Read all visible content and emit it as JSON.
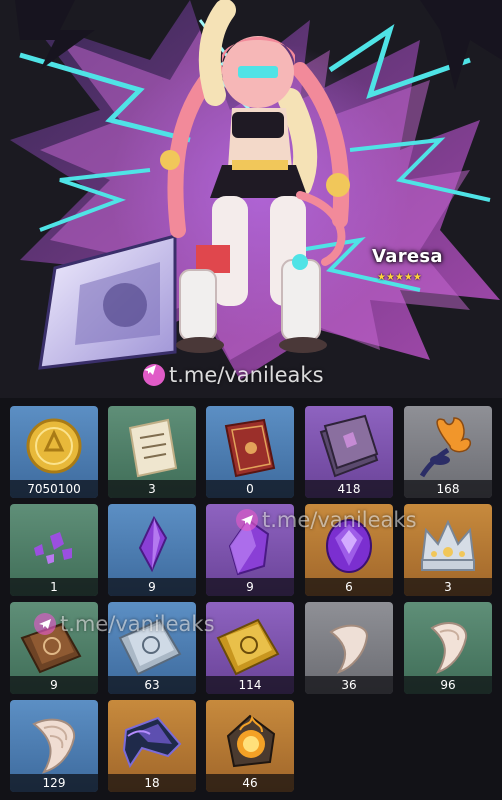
{
  "character": {
    "name": "Varesa",
    "stars": "★★★★★"
  },
  "watermark": {
    "text": "t.me/vanileaks"
  },
  "items": [
    {
      "count": "7050100",
      "icon": "mora-coin-icon",
      "rarity": "blue"
    },
    {
      "count": "3",
      "icon": "paper-note-icon",
      "rarity": "green"
    },
    {
      "count": "0",
      "icon": "red-book-icon",
      "rarity": "blue"
    },
    {
      "count": "418",
      "icon": "purple-book-stack-icon",
      "rarity": "purple"
    },
    {
      "count": "168",
      "icon": "orange-flower-icon",
      "rarity": "grey"
    },
    {
      "count": "1",
      "icon": "gem-shards-icon",
      "rarity": "green"
    },
    {
      "count": "9",
      "icon": "gem-fragment-icon",
      "rarity": "blue"
    },
    {
      "count": "9",
      "icon": "gem-chunk-icon",
      "rarity": "purple"
    },
    {
      "count": "6",
      "icon": "gemstone-icon",
      "rarity": "gold"
    },
    {
      "count": "3",
      "icon": "crown-icon",
      "rarity": "gold"
    },
    {
      "count": "9",
      "icon": "bronze-talent-book-icon",
      "rarity": "green"
    },
    {
      "count": "63",
      "icon": "silver-talent-book-icon",
      "rarity": "blue"
    },
    {
      "count": "114",
      "icon": "gold-talent-book-icon",
      "rarity": "purple"
    },
    {
      "count": "36",
      "icon": "claw-icon",
      "rarity": "grey"
    },
    {
      "count": "96",
      "icon": "claw-icon",
      "rarity": "green"
    },
    {
      "count": "129",
      "icon": "claw-icon",
      "rarity": "blue"
    },
    {
      "count": "18",
      "icon": "dark-blade-icon",
      "rarity": "gold"
    },
    {
      "count": "46",
      "icon": "flame-core-icon",
      "rarity": "gold"
    }
  ],
  "colors": {
    "background": "#16161b",
    "rarity_blue": "#4f7fb4",
    "rarity_green": "#4f7f68",
    "rarity_purple": "#7d55ae",
    "rarity_gold": "#b67a34",
    "rarity_grey": "#7e7f85",
    "star": "#ffd43b",
    "watermark_icon": "#e05bc7"
  }
}
